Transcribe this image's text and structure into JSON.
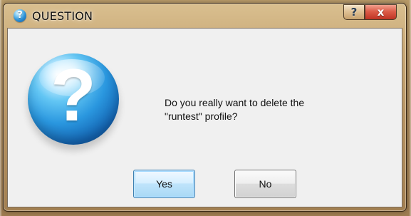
{
  "dialog": {
    "title": "QUESTION",
    "title_icon_glyph": "?",
    "icon_name": "question-icon",
    "message_lines": [
      "Do you really want to delete the",
      "\"runtest\" profile?"
    ],
    "buttons": {
      "yes": "Yes",
      "no": "No",
      "help": "?",
      "close": "x"
    }
  },
  "colors": {
    "title_bar": "#c9a977",
    "client_background": "#f0f0f0",
    "close_button": "#dc5c48",
    "default_button_border": "#3c7fb1"
  }
}
